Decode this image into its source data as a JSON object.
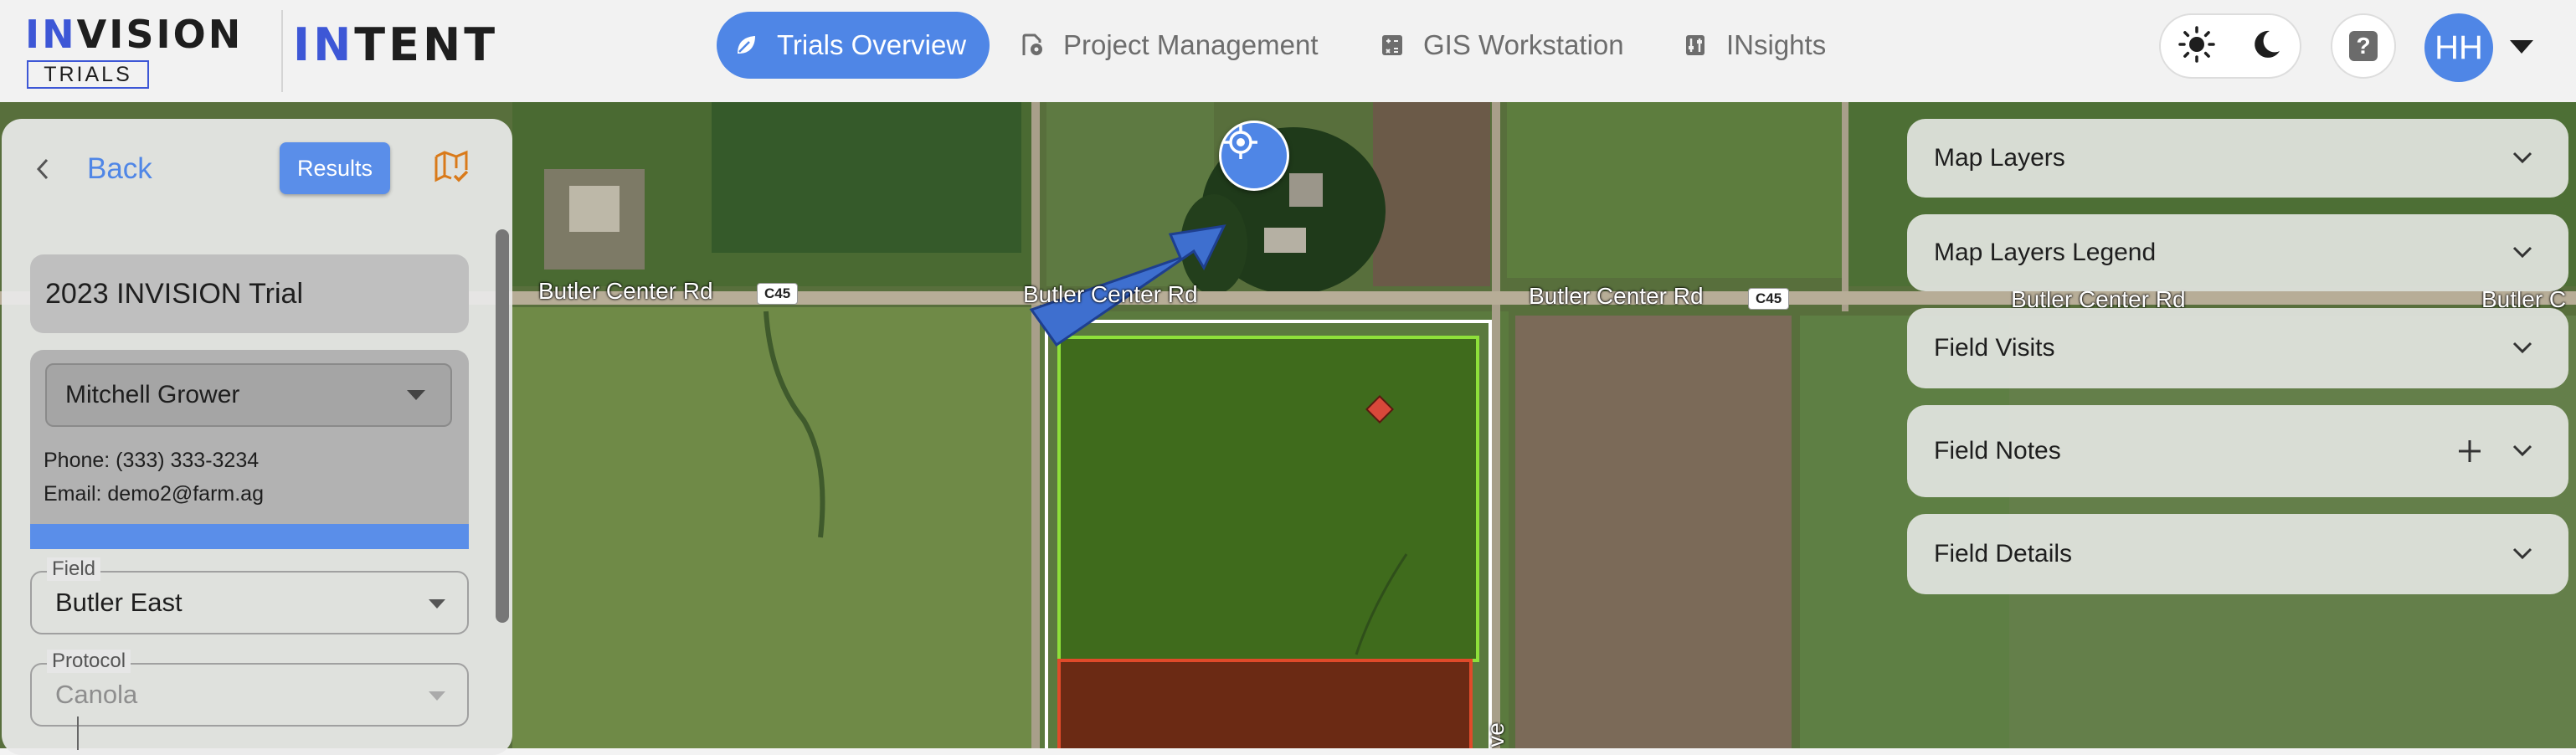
{
  "brand": {
    "invision_prefix": "IN",
    "invision_rest": "VISION",
    "trials": "TRIALS",
    "intent_prefix": "IN",
    "intent_rest": "TENT"
  },
  "nav": {
    "trials_overview": "Trials Overview",
    "project_management": "Project Management",
    "gis_workstation": "GIS Workstation",
    "insights": "INsights"
  },
  "user": {
    "initials": "HH"
  },
  "left_panel": {
    "back_label": "Back",
    "results_label": "Results",
    "trial_name": "2023 INVISION Trial",
    "grower": "Mitchell Grower",
    "phone": "Phone: (333) 333-3234",
    "email": "Email: demo2@farm.ag",
    "field_legend": "Field",
    "field_value": "Butler East",
    "protocol_legend": "Protocol",
    "protocol_value": "Canola"
  },
  "map": {
    "roads": [
      "Butler Center Rd",
      "Butler Center Rd",
      "Butler Center Rd",
      "Butler Center Rd",
      "Butler C"
    ],
    "route_badge": "C45",
    "side_road_fragment": "ve"
  },
  "accordion": {
    "map_layers": "Map Layers",
    "map_layers_legend": "Map Layers Legend",
    "field_visits": "Field Visits",
    "field_notes": "Field Notes",
    "field_details": "Field Details"
  },
  "colors": {
    "accent": "#4f86e6",
    "brand_blue": "#3d57d6",
    "boundary_green": "#8ee03a",
    "boundary_red": "#e04a2a"
  }
}
